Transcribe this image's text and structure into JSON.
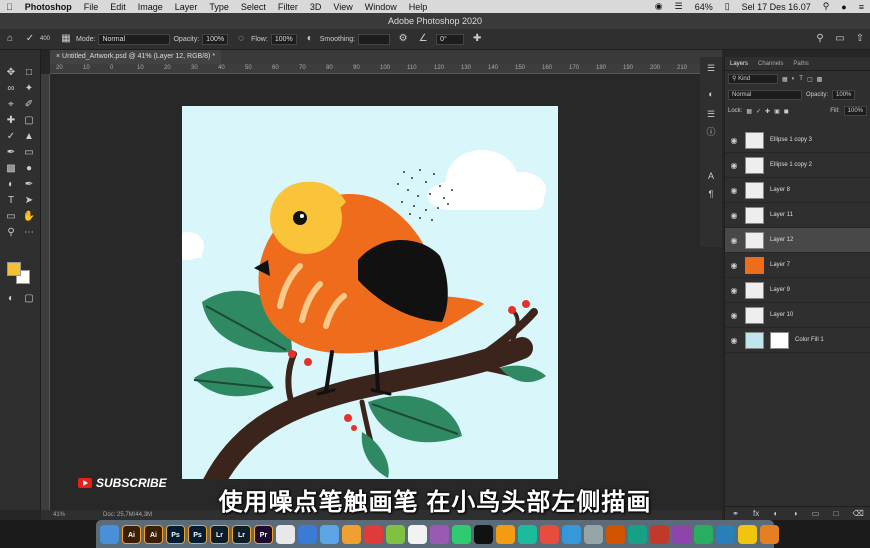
{
  "menubar": {
    "app": "Photoshop",
    "items": [
      "File",
      "Edit",
      "Image",
      "Layer",
      "Type",
      "Select",
      "Filter",
      "3D",
      "View",
      "Window",
      "Help"
    ],
    "battery": "64%",
    "clock": "Sel 17 Des  16.07"
  },
  "window_title": "Adobe Photoshop 2020",
  "options": {
    "brush_size": "400",
    "mode_label": "Mode:",
    "mode_value": "Normal",
    "opacity_label": "Opacity:",
    "opacity_value": "100%",
    "flow_label": "Flow:",
    "flow_value": "100%",
    "smoothing_label": "Smoothing:",
    "angle_value": "0°"
  },
  "document": {
    "tab_title": "Untitled_Artwork.psd @ 41% (Layer 12, RGB/8) *",
    "zoom": "41%",
    "doc_info": "Doc: 25,7M/44,3M"
  },
  "ruler_ticks": [
    "20",
    "10",
    "0",
    "10",
    "20",
    "30",
    "40",
    "50",
    "60",
    "70",
    "80",
    "90",
    "100",
    "110",
    "120",
    "130",
    "140",
    "150",
    "160",
    "170",
    "180",
    "190",
    "200",
    "210",
    "220"
  ],
  "layers_panel": {
    "tabs": [
      "Layers",
      "Channels",
      "Paths"
    ],
    "kind_label": "Kind",
    "blend_mode": "Normal",
    "opacity_label": "Opacity:",
    "opacity_value": "100%",
    "lock_label": "Lock:",
    "fill_label": "Fill:",
    "fill_value": "100%",
    "layers": [
      {
        "name": "Ellipse 1 copy 3",
        "selected": false
      },
      {
        "name": "Ellipse 1 copy 2",
        "selected": false
      },
      {
        "name": "Layer 8",
        "selected": false
      },
      {
        "name": "Layer 11",
        "selected": false
      },
      {
        "name": "Layer 12",
        "selected": true
      },
      {
        "name": "Layer 7",
        "selected": false
      },
      {
        "name": "Layer 9",
        "selected": false
      },
      {
        "name": "Layer 10",
        "selected": false
      },
      {
        "name": "Color Fill 1",
        "selected": false
      }
    ]
  },
  "overlay": {
    "subscribe": "SUBSCRIBE",
    "subtitle": "使用噪点笔触画笔 在小鸟头部左侧描画"
  },
  "dock": [
    {
      "label": "Ai",
      "color": "#3a1f05"
    },
    {
      "label": "Ai",
      "color": "#3a1f05"
    },
    {
      "label": "Ps",
      "color": "#001d33"
    },
    {
      "label": "Ps",
      "color": "#001d33"
    },
    {
      "label": "Lr",
      "color": "#0d1e2b"
    },
    {
      "label": "Lr",
      "color": "#0d1e2b"
    },
    {
      "label": "Pr",
      "color": "#1d0b2e"
    }
  ],
  "colors": {
    "sky": "#d9f6fb",
    "bird_orange": "#ef6c1d",
    "bird_yellow": "#f9c33a",
    "wing": "#111111",
    "leaf": "#2f8a63",
    "branch": "#3a241c",
    "berry": "#e5312a",
    "foreground_swatch": "#f5c035"
  }
}
